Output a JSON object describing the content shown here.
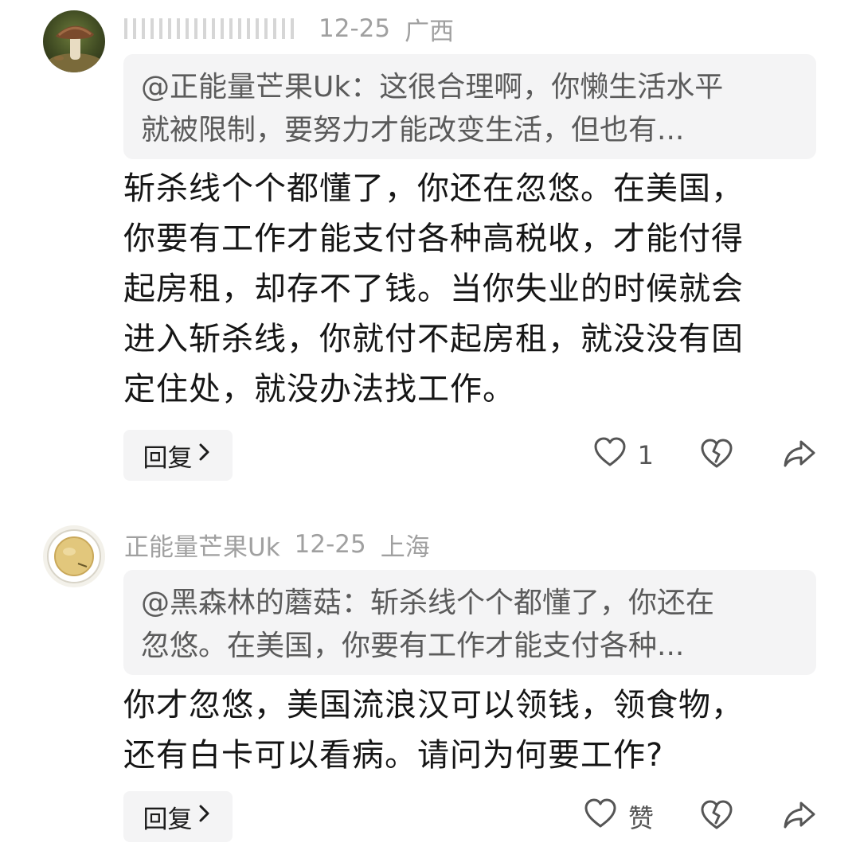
{
  "comments": [
    {
      "author": "",
      "date": "12-25",
      "location": "广西",
      "quote_line1": "@正能量芒果Uk：这很合理啊，你懒生活水平",
      "quote_line2": "就被限制，要努力才能改变生活，但也有...",
      "body_line1": "斩杀线个个都懂了，你还在忽悠。在美国，",
      "body_line2": "你要有工作才能支付各种高税收，才能付得",
      "body_line3": "起房租，却存不了钱。当你失业的时候就会",
      "body_line4": "进入斩杀线，你就付不起房租，就没没有固",
      "body_line5": "定住处，就没办法找工作。",
      "reply_label": "回复",
      "like_label": "1",
      "avatar_icon": "mushroom-avatar-icon"
    },
    {
      "author": "正能量芒果Uk",
      "date": "12-25",
      "location": "上海",
      "quote_line1": "@黑森林的蘑菇：斩杀线个个都懂了，你还在",
      "quote_line2": "忽悠。在美国，你要有工作才能支付各种...",
      "body_line1": "你才忽悠，美国流浪汉可以领钱，领食物，",
      "body_line2": "还有白卡可以看病。请问为何要工作?",
      "reply_label": "回复",
      "like_label": "赞",
      "avatar_icon": "tea-cup-avatar-icon"
    }
  ],
  "icons": {
    "like": "heart-outline-icon",
    "dislike": "broken-heart-icon",
    "share": "share-arrow-icon",
    "reply_chevron": "chevron-right-icon"
  }
}
